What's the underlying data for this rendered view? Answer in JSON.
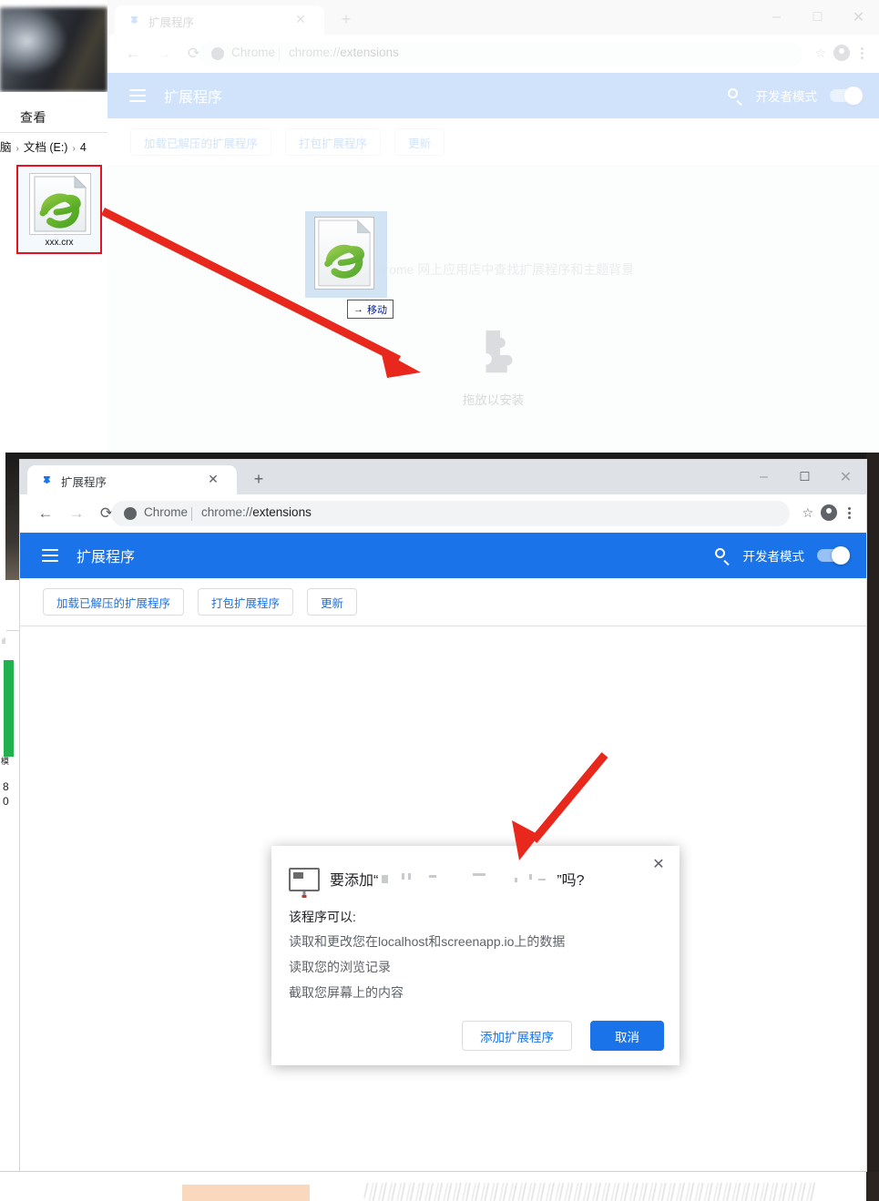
{
  "window_controls": {
    "minimize": "–",
    "maximize": "□",
    "close": "✕"
  },
  "explorer": {
    "ribbon_tab": "查看",
    "breadcrumb": {
      "part1": "脑",
      "part2": "文档 (E:)",
      "part3": "4",
      "sep": "›"
    },
    "file": {
      "name": "xxx.crx",
      "icon": "ie-crx-file-icon"
    }
  },
  "drag": {
    "badge_label": "移动",
    "badge_arrow": "→",
    "ghost_icon": "ie-crx-file-icon"
  },
  "browser_top": {
    "tab": {
      "title": "扩展程序",
      "favicon": "puzzle-icon",
      "close": "✕"
    },
    "new_tab": "+",
    "nav": {
      "back": "←",
      "forward": "→",
      "reload": "⟳"
    },
    "omnibox": {
      "scheme_label": "Chrome",
      "divider": "|",
      "url_prefix": "chrome://",
      "url_suffix": "extensions",
      "site_icon": "chrome-icon"
    },
    "star": "☆",
    "profile": "profile-avatar-icon",
    "menu": "kebab-menu-icon"
  },
  "extensions_page_top": {
    "header_title": "扩展程序",
    "menu_icon": "hamburger-icon",
    "search_icon": "search-icon",
    "dev_mode_label": "开发者模式",
    "dev_mode_on": true,
    "actions": [
      "加载已解压的扩展程序",
      "打包扩展程序",
      "更新"
    ],
    "empty_hint": "在 Chrome 网上应用店中查找扩展程序和主题背景",
    "drop_label": "拖放以安装",
    "drop_icon": "puzzle-icon"
  },
  "browser_bottom": {
    "tab": {
      "title": "扩展程序",
      "favicon": "puzzle-icon",
      "close": "✕"
    },
    "new_tab": "+",
    "nav": {
      "back": "←",
      "forward": "→",
      "reload": "⟳"
    },
    "omnibox": {
      "scheme_label": "Chrome",
      "divider": "|",
      "url_prefix": "chrome://",
      "url_suffix": "extensions",
      "site_icon": "chrome-icon"
    },
    "star": "☆",
    "profile": "profile-avatar-icon",
    "menu": "kebab-menu-icon"
  },
  "extensions_page_bottom": {
    "header_title": "扩展程序",
    "menu_icon": "hamburger-icon",
    "search_icon": "search-icon",
    "dev_mode_label": "开发者模式",
    "dev_mode_on": true,
    "actions": [
      "加载已解压的扩展程序",
      "打包扩展程序",
      "更新"
    ]
  },
  "dialog": {
    "icon": "monitor-icon",
    "close": "✕",
    "title_prefix": "要添加“",
    "extension_name_redacted": "",
    "title_suffix": "”吗?",
    "subtitle": "该程序可以:",
    "permissions": [
      "读取和更改您在localhost和screenapp.io上的数据",
      "读取您的浏览记录",
      "截取您屏幕上的内容"
    ],
    "confirm_label": "添加扩展程序",
    "cancel_label": "取消"
  },
  "annotations": {
    "arrow1": "red-arrow-from-file-to-dropzone",
    "arrow2": "red-arrow-pointing-to-add-extension-button"
  },
  "background_fragments": {
    "number_top": "8",
    "number_bottom": "0",
    "tiny_label": "il",
    "cjk_label": "模"
  },
  "colors": {
    "chrome_blue": "#1a73e8",
    "tabstrip": "#dee1e6",
    "page_bg": "#f1f3f4",
    "arrow_red": "#e8271d",
    "selection_red": "#e81123",
    "green": "#22b14c"
  }
}
